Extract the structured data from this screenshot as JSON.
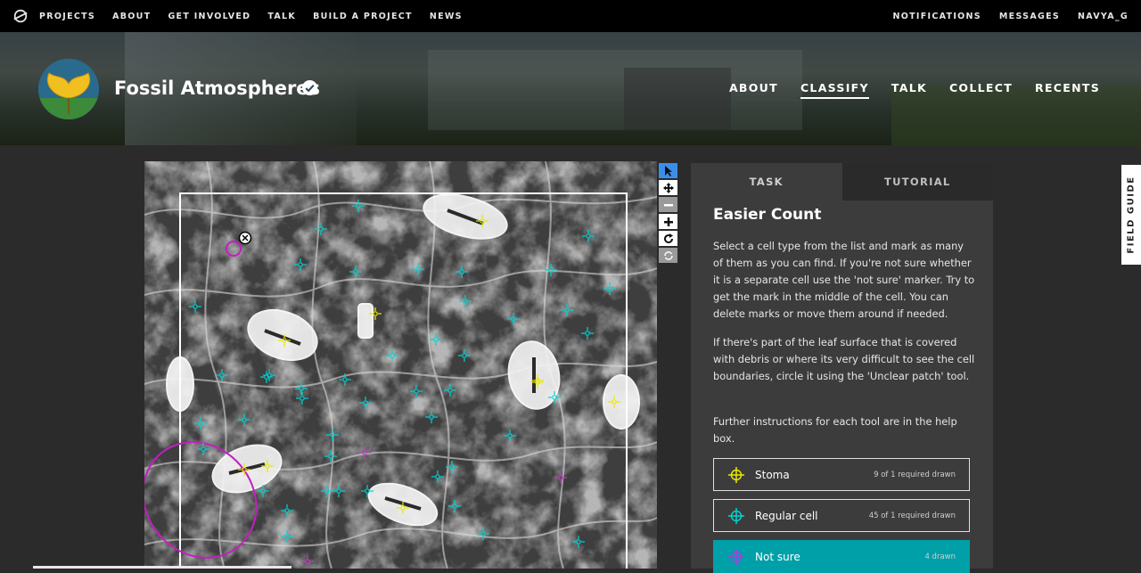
{
  "topnav": {
    "links": [
      "PROJECTS",
      "ABOUT",
      "GET INVOLVED",
      "TALK",
      "BUILD A PROJECT",
      "NEWS"
    ],
    "right": [
      "NOTIFICATIONS",
      "MESSAGES",
      "NAVYA_G"
    ]
  },
  "project": {
    "title": "Fossil Atmospheres",
    "nav": [
      "ABOUT",
      "CLASSIFY",
      "TALK",
      "COLLECT",
      "RECENTS"
    ],
    "active_nav": "CLASSIFY"
  },
  "toolbar": {
    "icons": [
      "pointer-icon",
      "move-icon",
      "zoom-out-icon",
      "zoom-in-icon",
      "rotate-icon",
      "reset-icon"
    ]
  },
  "panel": {
    "tabs": [
      "TASK",
      "TUTORIAL"
    ],
    "title": "Easier Count",
    "paragraphs": [
      "Select a cell type from the list and mark as many of them as you can find. If you're not sure whether it is a separate cell use the 'not sure' marker. Try to get the mark in the middle of the cell. You can delete marks or move them around if needed.",
      "If there's part of the leaf surface that is covered with debris or where its very difficult to see the cell boundaries, circle it using the 'Unclear patch' tool.",
      "Further instructions for each tool are in the help box."
    ],
    "tools": [
      {
        "label": "Stoma",
        "count": "9 of 1 required drawn",
        "color": "#e8e800"
      },
      {
        "label": "Regular cell",
        "count": "45 of 1 required drawn",
        "color": "#00d4d4"
      },
      {
        "label": "Not sure",
        "count": "4 drawn",
        "color": "#a040e0"
      }
    ]
  },
  "field_guide": "FIELD GUIDE",
  "colors": {
    "accent": "#00a0a8",
    "stoma_mark": "#e8e800",
    "cell_mark": "#00d4d4",
    "unsure_mark": "#c040c0"
  }
}
